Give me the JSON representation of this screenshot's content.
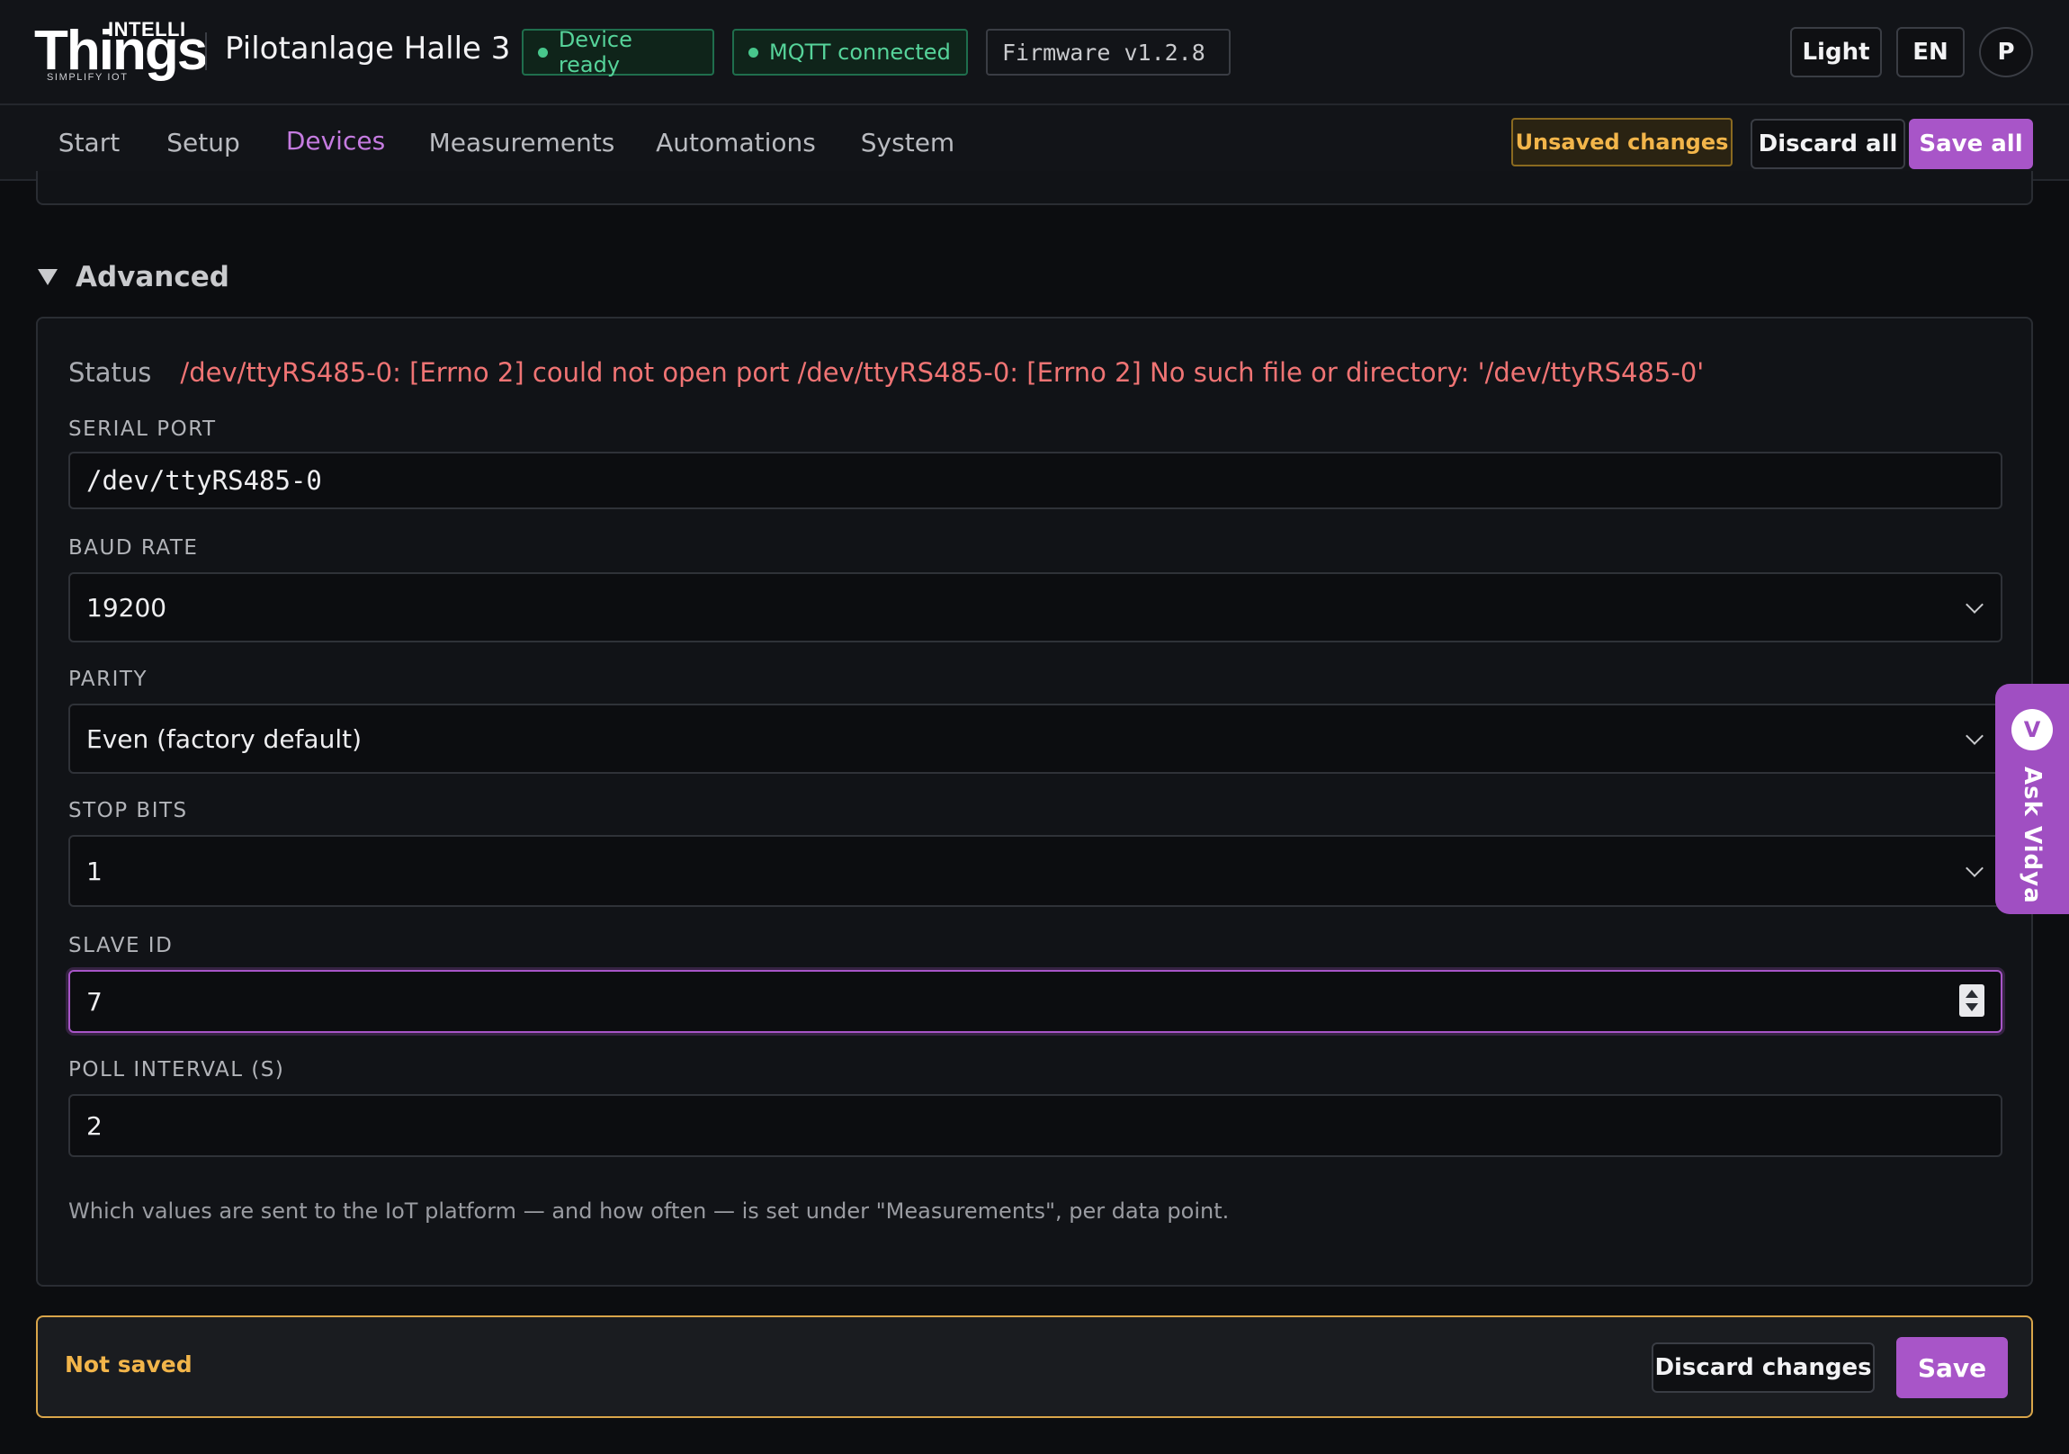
{
  "header": {
    "logo": {
      "intelli": "INTELLI",
      "things": "Things",
      "tagline": "SIMPLIFY IOT"
    },
    "site_title": "Pilotanlage Halle 3",
    "status_pills": {
      "device": "Device ready",
      "mqtt": "MQTT connected",
      "firmware": "Firmware v1.2.8"
    },
    "theme_button": "Light",
    "language_button": "EN",
    "avatar_initial": "P"
  },
  "nav": {
    "tabs": [
      {
        "label": "Start"
      },
      {
        "label": "Setup"
      },
      {
        "label": "Devices",
        "active": true
      },
      {
        "label": "Measurements"
      },
      {
        "label": "Automations"
      },
      {
        "label": "System"
      }
    ],
    "unsaved_badge": "Unsaved changes",
    "discard_all": "Discard all",
    "save_all": "Save all"
  },
  "advanced": {
    "section_title": "Advanced",
    "status_label": "Status",
    "status_value": "/dev/ttyRS485-0: [Errno 2] could not open port /dev/ttyRS485-0: [Errno 2] No such file or directory: '/dev/ttyRS485-0'",
    "fields": {
      "serial_port": {
        "label": "SERIAL PORT",
        "value": "/dev/ttyRS485-0"
      },
      "baud_rate": {
        "label": "BAUD RATE",
        "value": "19200"
      },
      "parity": {
        "label": "PARITY",
        "value": "Even (factory default)"
      },
      "stop_bits": {
        "label": "STOP BITS",
        "value": "1"
      },
      "slave_id": {
        "label": "SLAVE ID",
        "value": "7"
      },
      "poll_interval": {
        "label": "POLL INTERVAL (S)",
        "value": "2"
      }
    },
    "help_text": "Which values are sent to the IoT platform — and how often — is set under \"Measurements\", per data point."
  },
  "save_bar": {
    "status": "Not saved",
    "discard_changes": "Discard changes",
    "save": "Save"
  },
  "assistant": {
    "badge": "V",
    "label": "Ask Vidya"
  },
  "colors": {
    "accent": "#a855c8",
    "success": "#48c78c",
    "warning": "#f2b54a",
    "error": "#f07474",
    "background": "#0c0d10"
  }
}
